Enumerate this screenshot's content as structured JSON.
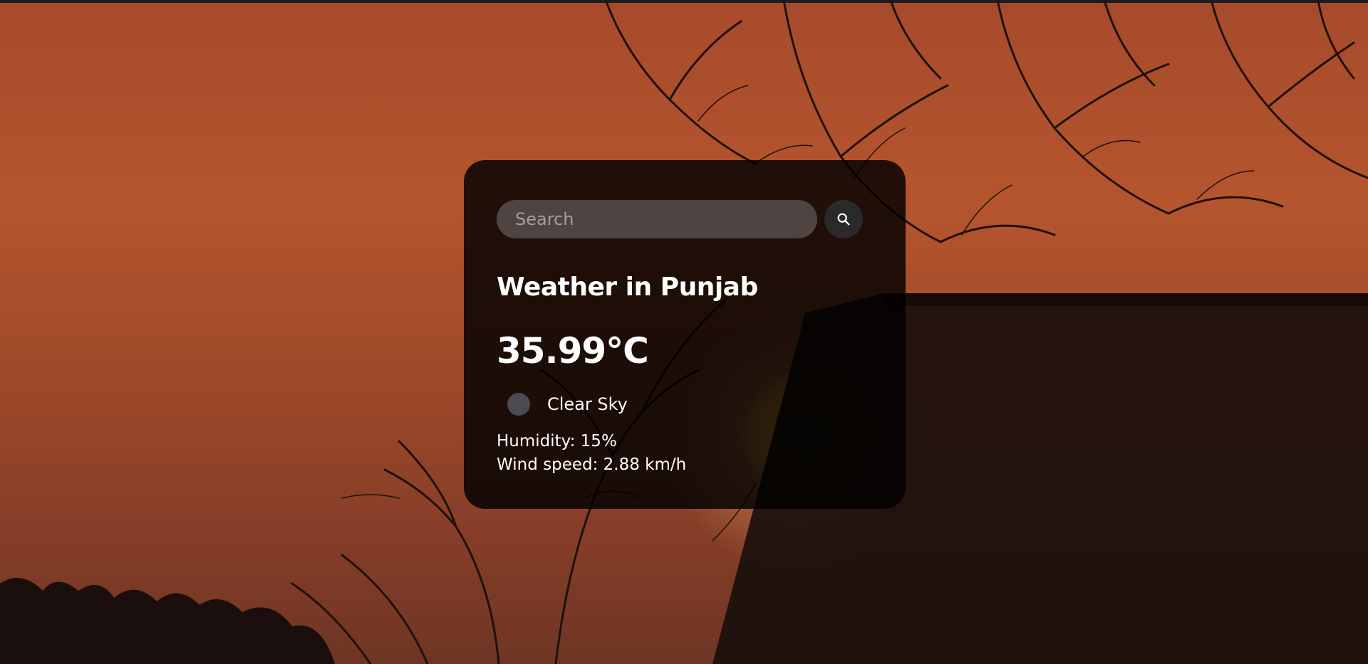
{
  "search": {
    "placeholder": "Search",
    "button_icon": "search-icon"
  },
  "weather": {
    "title": "Weather in Punjab",
    "temperature": "35.99°C",
    "icon": "weather-condition-icon",
    "description": "Clear Sky",
    "humidity": "Humidity: 15%",
    "wind": "Wind speed: 2.88 km/h"
  },
  "colors": {
    "sky": "#a64a2b",
    "card": "#000000",
    "text": "#ffffff",
    "input": "#4e4542"
  }
}
